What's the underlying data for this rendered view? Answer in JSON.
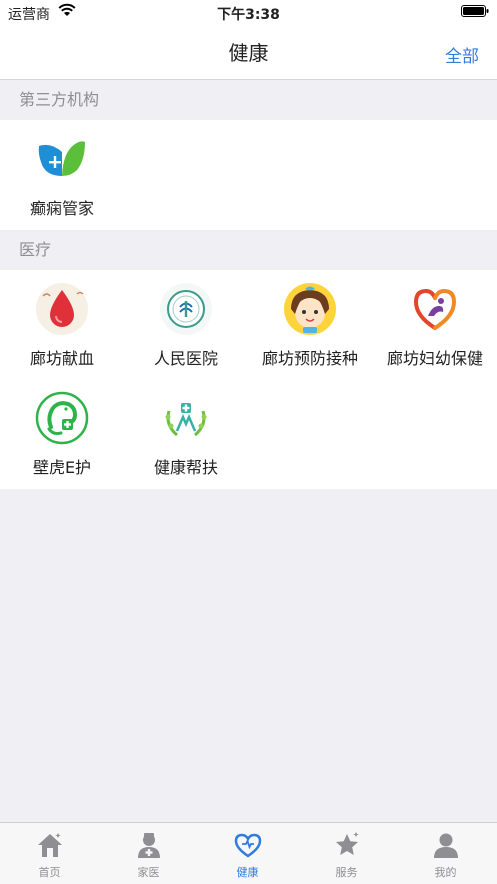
{
  "status_bar": {
    "carrier": "运营商",
    "time": "下午3:38"
  },
  "nav": {
    "title": "健康",
    "right_button": "全部"
  },
  "sections": [
    {
      "header": "第三方机构",
      "items": [
        {
          "label": "癫痫管家",
          "icon": "leaf-plus-icon"
        }
      ]
    },
    {
      "header": "医疗",
      "items": [
        {
          "label": "廊坊献血",
          "icon": "blood-drop-icon"
        },
        {
          "label": "人民医院",
          "icon": "hospital-logo-icon"
        },
        {
          "label": "廊坊预防接种",
          "icon": "child-face-icon"
        },
        {
          "label": "廊坊妇幼保健",
          "icon": "mother-child-icon"
        },
        {
          "label": "壁虎E护",
          "icon": "gecko-icon"
        },
        {
          "label": "健康帮扶",
          "icon": "wreath-icon"
        }
      ]
    }
  ],
  "tabs": [
    {
      "label": "首页",
      "icon": "home-icon",
      "active": false
    },
    {
      "label": "家医",
      "icon": "doctor-icon",
      "active": false
    },
    {
      "label": "健康",
      "icon": "heart-icon",
      "active": true
    },
    {
      "label": "服务",
      "icon": "star-icon",
      "active": false
    },
    {
      "label": "我的",
      "icon": "person-icon",
      "active": false
    }
  ],
  "colors": {
    "accent": "#2f7de1",
    "background": "#efeff4",
    "tab_inactive": "#8e8e93"
  }
}
